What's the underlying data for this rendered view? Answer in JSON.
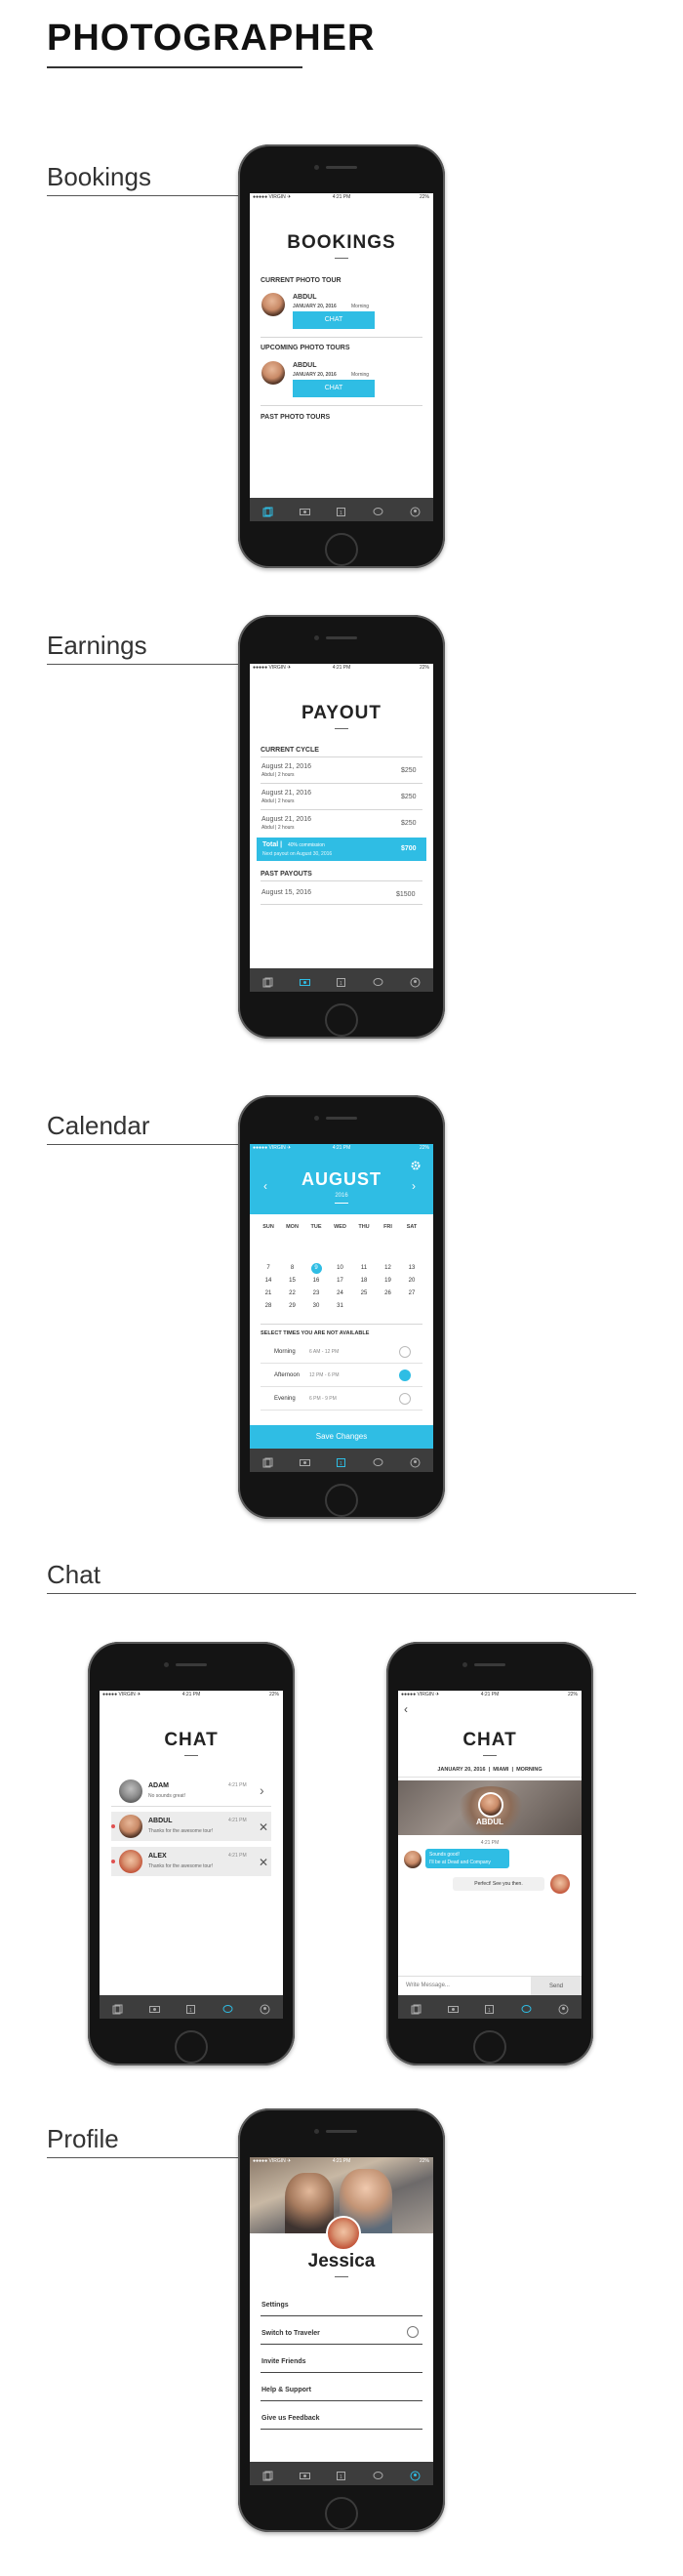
{
  "page": {
    "title": "PHOTOGRAPHER"
  },
  "sections": {
    "bookings": "Bookings",
    "earnings": "Earnings",
    "calendar": "Calendar",
    "chat": "Chat",
    "profile": "Profile"
  },
  "status": {
    "carrier": "●●●●● VIRGIN ✈",
    "time": "4:21 PM",
    "battery": "22%"
  },
  "bookings": {
    "title": "BOOKINGS",
    "current_label": "CURRENT PHOTO TOUR",
    "current": {
      "name": "ABDUL",
      "date": "JANUARY 20, 2016",
      "slot": "Morning",
      "button": "CHAT"
    },
    "upcoming_label": "UPCOMING PHOTO TOURS",
    "upcoming": {
      "name": "ABDUL",
      "date": "JANUARY 20, 2016",
      "slot": "Morning",
      "button": "CHAT"
    },
    "past_label": "PAST PHOTO TOURS"
  },
  "payout": {
    "title": "PAYOUT",
    "cycle_label": "CURRENT CYCLE",
    "rows": [
      {
        "date": "August 21, 2016",
        "sub": "Abdul | 2 hours",
        "amount": "$250"
      },
      {
        "date": "August 21, 2016",
        "sub": "Abdul | 2 hours",
        "amount": "$250"
      },
      {
        "date": "August 21, 2016",
        "sub": "Abdul | 2 hours",
        "amount": "$250"
      }
    ],
    "total_label": "Total |",
    "total_note": "40% commission",
    "total_sub": "Next payout on August 30, 2016",
    "total_amount": "$700",
    "past_label": "PAST PAYOUTS",
    "past_rows": [
      {
        "date": "August 15, 2016",
        "amount": "$1500"
      }
    ]
  },
  "calendar": {
    "month": "AUGUST",
    "year": "2016",
    "days": [
      "SUN",
      "MON",
      "TUE",
      "WED",
      "THU",
      "FRI",
      "SAT"
    ],
    "weeks": [
      [
        "",
        "",
        "",
        "",
        "",
        "",
        ""
      ],
      [
        "",
        "",
        "",
        "",
        "",
        "",
        ""
      ],
      [
        "7",
        "8",
        "9",
        "10",
        "11",
        "12",
        "13"
      ],
      [
        "14",
        "15",
        "16",
        "17",
        "18",
        "19",
        "20"
      ],
      [
        "21",
        "22",
        "23",
        "24",
        "25",
        "26",
        "27"
      ],
      [
        "28",
        "29",
        "30",
        "31",
        "",
        "",
        ""
      ]
    ],
    "selected_day": "9",
    "select_label": "SELECT TIMES YOU ARE NOT AVAILABLE",
    "times": [
      {
        "name": "Morning",
        "range": "6 AM - 12 PM",
        "checked": false
      },
      {
        "name": "Afternoon",
        "range": "12 PM - 6 PM",
        "checked": true
      },
      {
        "name": "Evening",
        "range": "6 PM - 9 PM",
        "checked": false
      }
    ],
    "save": "Save Changes"
  },
  "chatlist": {
    "title": "CHAT",
    "items": [
      {
        "name": "ADAM",
        "time": "4:21 PM",
        "msg": "No sounds great!"
      },
      {
        "name": "ABDUL",
        "time": "4:21 PM",
        "msg": "Thanks for the awesome tour!"
      },
      {
        "name": "ALEX",
        "time": "4:21 PM",
        "msg": "Thanks for the awesome tour!"
      }
    ]
  },
  "chatdetail": {
    "title": "CHAT",
    "meta_date": "JANUARY 20, 2016",
    "meta_city": "MIAMI",
    "meta_slot": "MORNING",
    "name": "ABDUL",
    "time": "4:21 PM",
    "bubble1": "Sounds good!",
    "bubble1b": "I'll be at Dead and Company",
    "bubble2": "Perfect! See you then.",
    "input_placeholder": "Write Message...",
    "send": "Send"
  },
  "profile": {
    "name": "Jessica",
    "menu": [
      "Settings",
      "Switch to Traveler",
      "Invite Friends",
      "Help & Support",
      "Give us Feedback"
    ]
  },
  "colors": {
    "accent": "#2fbde4",
    "dark": "#3d3d3d"
  }
}
